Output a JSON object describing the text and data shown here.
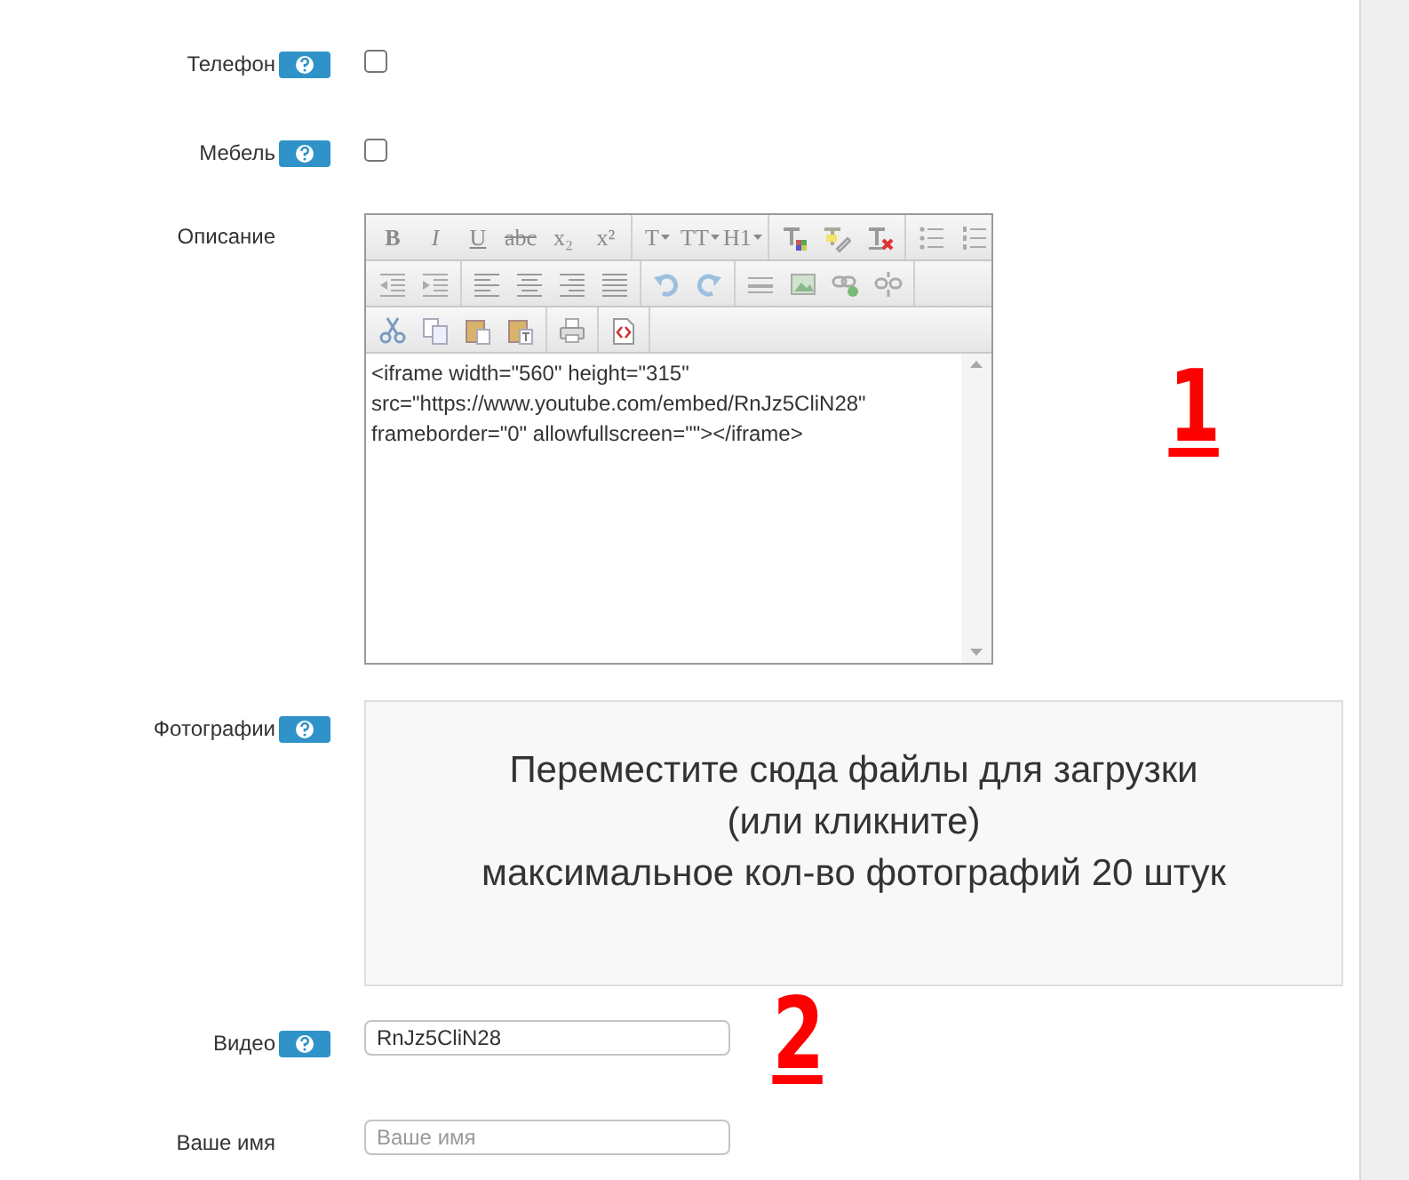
{
  "fields": [
    {
      "kind": "checkbox",
      "label": "Телефон",
      "help": true,
      "checked": false
    },
    {
      "kind": "checkbox",
      "label": "Мебель",
      "help": true,
      "checked": false
    },
    {
      "kind": "editor",
      "label": "Описание",
      "help": false,
      "toolbar": [
        [
          [
            {
              "kind": "text",
              "label": "B"
            },
            {
              "kind": "text",
              "label": "I"
            },
            {
              "kind": "text",
              "label": "U"
            },
            {
              "kind": "text",
              "label": "abc"
            },
            {
              "kind": "text",
              "label": "x₂"
            },
            {
              "kind": "text",
              "label": "x²"
            }
          ],
          [
            {
              "kind": "dropdown",
              "label": "T"
            },
            {
              "kind": "dropdown",
              "label": "TT"
            },
            {
              "kind": "dropdown",
              "label": "H1"
            }
          ],
          [
            {
              "kind": "icon"
            },
            {
              "kind": "icon"
            },
            {
              "kind": "icon"
            }
          ],
          [
            {
              "kind": "icon"
            },
            {
              "kind": "icon"
            }
          ]
        ],
        [
          [
            {
              "kind": "icon"
            },
            {
              "kind": "icon"
            }
          ],
          [
            {
              "kind": "icon"
            },
            {
              "kind": "icon"
            },
            {
              "kind": "icon"
            },
            {
              "kind": "icon"
            }
          ],
          [
            {
              "kind": "icon"
            },
            {
              "kind": "icon"
            }
          ],
          [
            {
              "kind": "icon"
            },
            {
              "kind": "icon"
            },
            {
              "kind": "icon"
            },
            {
              "kind": "icon"
            }
          ]
        ],
        [
          [
            {
              "kind": "icon"
            },
            {
              "kind": "icon"
            },
            {
              "kind": "icon"
            },
            {
              "kind": "icon"
            }
          ],
          [
            {
              "kind": "icon"
            }
          ],
          [
            {
              "kind": "icon"
            }
          ]
        ]
      ],
      "value": "<iframe width=\"560\" height=\"315\" src=\"https://www.youtube.com/embed/RnJz5CliN28\" frameborder=\"0\" allowfullscreen=\"\"></iframe>"
    },
    {
      "kind": "dropzone",
      "label": "Фотографии",
      "help": true,
      "lines": [
        "Переместите сюда файлы для загрузки",
        "(или кликните)",
        "максимальное кол-во фотографий 20 штук"
      ]
    },
    {
      "kind": "text",
      "label": "Видео",
      "help": true,
      "value": "RnJz5CliN28"
    },
    {
      "kind": "text",
      "label": "Ваше имя",
      "help": false,
      "placeholder": "Ваше имя"
    }
  ],
  "annotations": [
    "1",
    "2"
  ]
}
